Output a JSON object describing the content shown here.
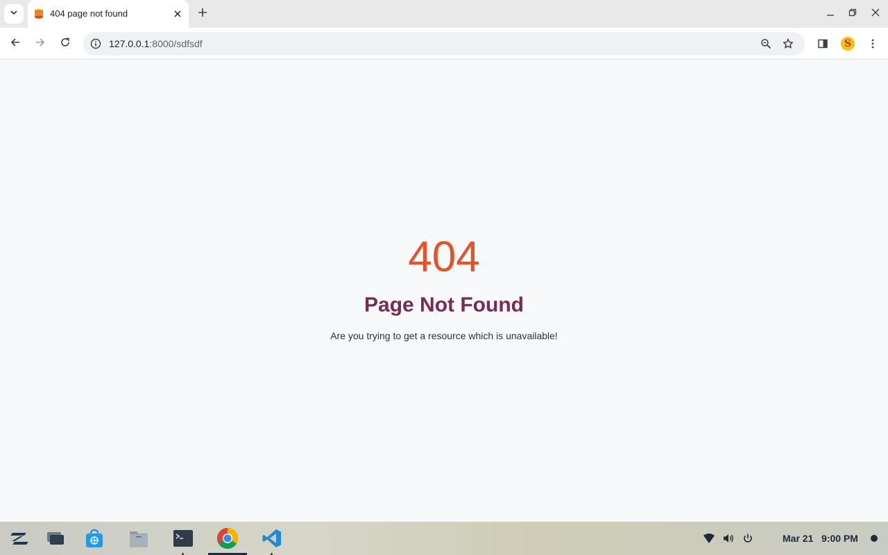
{
  "browser": {
    "tab": {
      "title": "404 page not found",
      "favicon": "stacked-database-icon"
    },
    "url": {
      "host": "127.0.0.1",
      "rest": ":8000/sdfsdf"
    },
    "profile_initial": "S"
  },
  "page": {
    "code": "404",
    "headline": "Page Not Found",
    "message": "Are you trying to get a resource which is unavailable!"
  },
  "taskbar": {
    "date": "Mar 21",
    "time": "9:00 PM"
  },
  "colors": {
    "error_code": "#e4532a",
    "headline": "#7a2a55",
    "page_background": "#f8f9fa"
  }
}
